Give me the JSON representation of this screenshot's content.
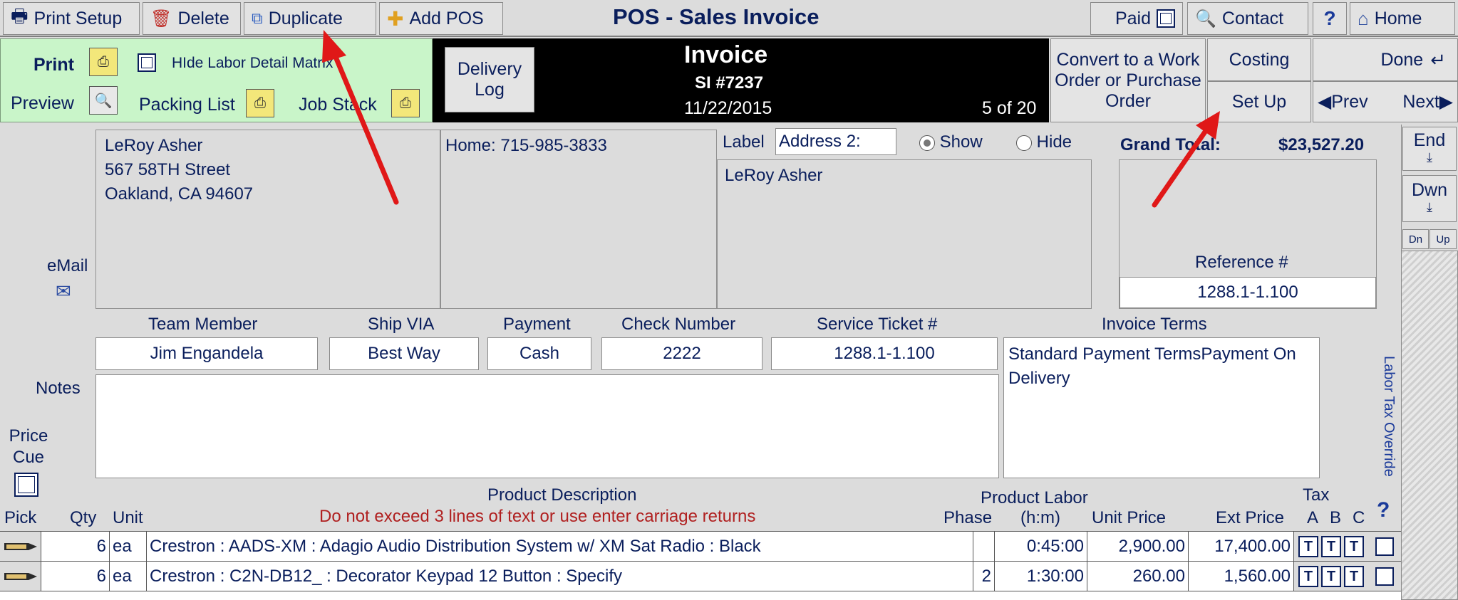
{
  "toolbar": {
    "print_setup": "Print Setup",
    "delete": "Delete",
    "duplicate": "Duplicate",
    "add_pos": "Add POS",
    "title": "POS - Sales Invoice",
    "paid": "Paid",
    "contact": "Contact",
    "help": "?",
    "home": "Home"
  },
  "print_panel": {
    "print": "Print",
    "preview": "Preview",
    "hide_labor": "HIde Labor Detail Matrix",
    "packing_list": "Packing List",
    "job_stack": "Job Stack"
  },
  "delivery_log": "Delivery Log",
  "invoice": {
    "title": "Invoice",
    "number": "SI #7237",
    "date": "11/22/2015",
    "count": "5 of 20"
  },
  "actions": {
    "convert": "Convert to a Work Order or Purchase Order",
    "costing": "Costing",
    "set_up": "Set Up",
    "done": "Done",
    "prev": "Prev",
    "next": "Next"
  },
  "customer": {
    "name": "LeRoy Asher",
    "street": "567 58TH Street",
    "city": "Oakland, CA 94607",
    "phone": "Home: 715-985-3833",
    "email_label": "eMail"
  },
  "address2": {
    "label": "Label",
    "value": "Address 2:",
    "show": "Show",
    "hide": "Hide",
    "name": "LeRoy Asher"
  },
  "totals": {
    "grand_total_label": "Grand Total:",
    "grand_total": "$23,527.20",
    "reference_label": "Reference #",
    "reference": "1288.1-1.100"
  },
  "nav": {
    "end": "End",
    "dwn": "Dwn",
    "dn": "Dn",
    "up": "Up"
  },
  "fields": {
    "team_member_label": "Team Member",
    "team_member": "Jim Engandela",
    "ship_via_label": "Ship VIA",
    "ship_via": "Best Way",
    "payment_label": "Payment",
    "payment": "Cash",
    "check_label": "Check Number",
    "check": "2222",
    "service_label": "Service Ticket #",
    "service": "1288.1-1.100",
    "terms_label": "Invoice Terms",
    "terms": "Standard Payment TermsPayment On Delivery",
    "notes_label": "Notes",
    "price_cue": "Price Cue"
  },
  "labor_tax_override": "Labor Tax Override",
  "table": {
    "pick": "Pick",
    "qty": "Qty",
    "unit": "Unit",
    "desc": "Product Description",
    "desc_warning": "Do not exceed 3 lines of text or use enter carriage returns",
    "phase": "Phase",
    "labor": "Product Labor",
    "labor_unit": "(h:m)",
    "unit_price": "Unit Price",
    "ext_price": "Ext Price",
    "tax": "Tax",
    "tax_a": "A",
    "tax_b": "B",
    "tax_c": "C",
    "tax_help": "?",
    "rows": [
      {
        "qty": "6",
        "unit": "ea",
        "desc": "Crestron : AADS-XM : Adagio Audio Distribution System w/ XM Sat Radio : Black",
        "phase": "",
        "labor": "0:45:00",
        "unit_price": "2,900.00",
        "ext_price": "17,400.00",
        "t": "T"
      },
      {
        "qty": "6",
        "unit": "ea",
        "desc": "Crestron : C2N-DB12_ : Decorator Keypad 12 Button : Specify",
        "phase": "2",
        "labor": "1:30:00",
        "unit_price": "260.00",
        "ext_price": "1,560.00",
        "t": "T"
      }
    ]
  },
  "colors": {
    "text": "#0a1e5c",
    "print_panel_bg": "#c9f5c9",
    "header_bg": "#000000",
    "annotation": "#e01818",
    "warning": "#b02020"
  }
}
